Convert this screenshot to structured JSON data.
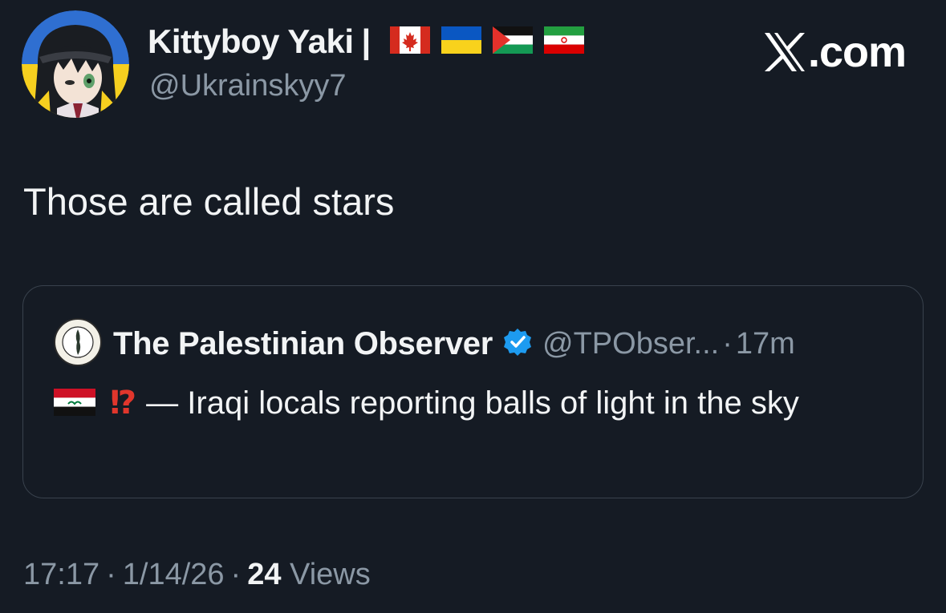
{
  "user": {
    "display_name": "Kittyboy Yaki",
    "name_separator": "|",
    "handle": "@Ukrainskyy7",
    "flags": [
      "canada-flag",
      "ukraine-flag",
      "palestine-flag",
      "iran-flag"
    ]
  },
  "brand": {
    "label": ".com"
  },
  "tweet": {
    "text": "Those are called stars"
  },
  "quote": {
    "name": "The Palestinian Observer",
    "handle": "@TPObser...",
    "dot": "·",
    "time": "17m",
    "emoji_exclamation": "⁉",
    "text": "— Iraqi locals reporting balls of light in the sky"
  },
  "footer": {
    "time": "17:17",
    "date": "1/14/26",
    "dot": "·",
    "views_count": "24",
    "views_label": "Views"
  },
  "colors": {
    "background": "#151b24",
    "text_primary": "#f2f4f5",
    "text_secondary": "#8b98a5",
    "border": "#39424d",
    "verified_blue": "#1d9bf0"
  }
}
